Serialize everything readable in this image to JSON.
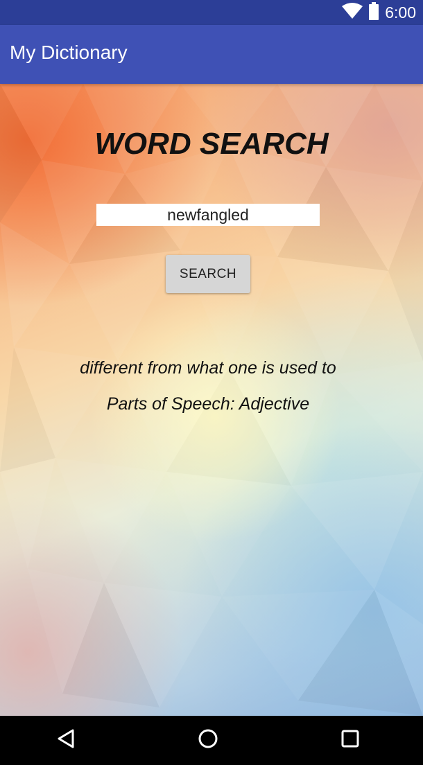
{
  "status_bar": {
    "time": "6:00",
    "icons": [
      "wifi-icon",
      "battery-icon"
    ],
    "color": "#2c3e97"
  },
  "app_bar": {
    "title": "My Dictionary",
    "color": "#3f51b5"
  },
  "main": {
    "heading": "WORD SEARCH",
    "search_input": {
      "value": "newfangled"
    },
    "search_button_label": "SEARCH",
    "definition": "different from what one is used to",
    "parts_of_speech": "Parts of Speech: Adjective"
  },
  "nav_bar": {
    "icons": [
      "back-icon",
      "home-icon",
      "recents-icon"
    ]
  }
}
